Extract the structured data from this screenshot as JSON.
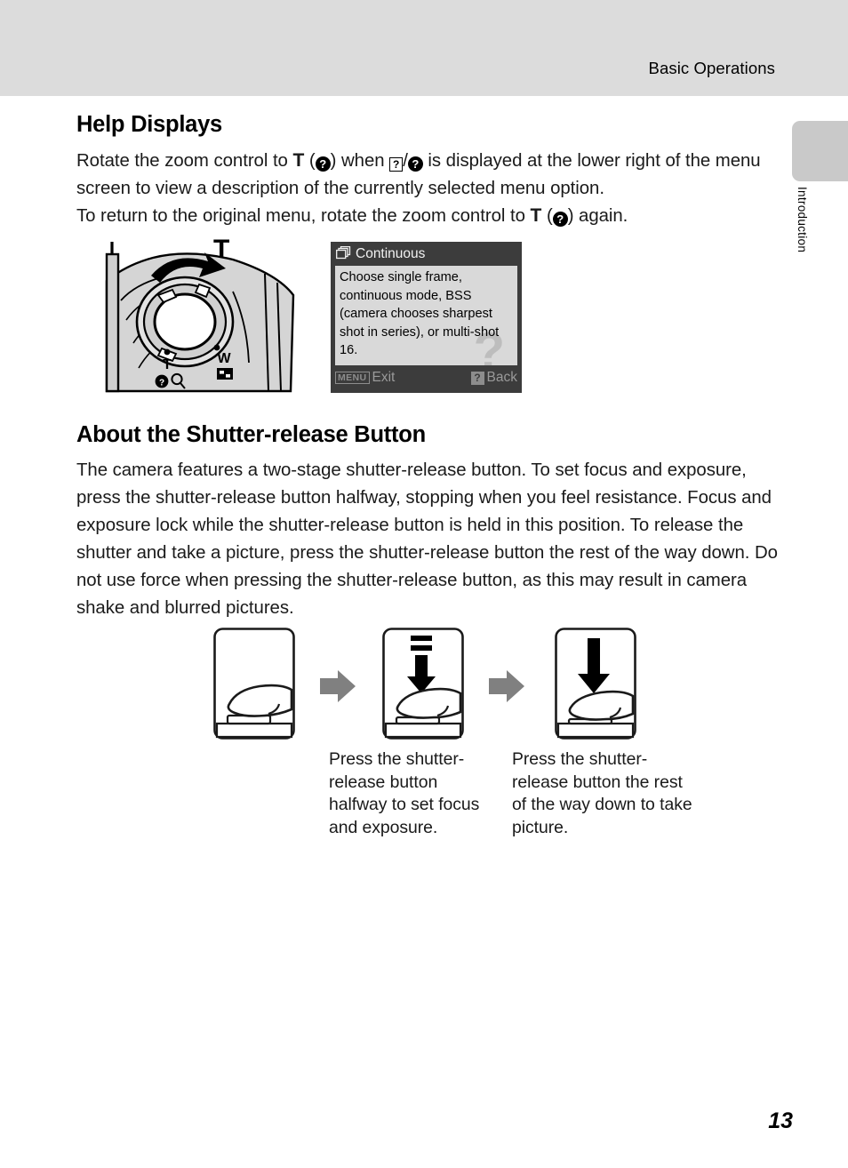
{
  "header": {
    "title": "Basic Operations"
  },
  "side_tab": {
    "label": "Introduction"
  },
  "sections": {
    "help_displays": {
      "heading": "Help Displays",
      "para1_a": "Rotate the zoom control to ",
      "para1_T": "T",
      "para1_b": " (",
      "para1_q1": "?",
      "para1_c": ") when ",
      "para1_q2": "?",
      "para1_slash": "/",
      "para1_q3": "?",
      "para1_d": " is displayed at the lower right of the menu screen to view a description of the currently selected menu option.",
      "para2_a": "To return to the original menu, rotate the zoom control to ",
      "para2_T": "T",
      "para2_b": " (",
      "para2_q": "?",
      "para2_c": ") again."
    },
    "shutter": {
      "heading": "About the Shutter-release Button",
      "body": "The camera features a two-stage shutter-release button. To set focus and exposure, press the shutter-release button halfway, stopping when you feel resistance. Focus and exposure lock while the shutter-release button is held in this position. To release the shutter and take a picture, press the shutter-release button the rest of the way down. Do not use force when pressing the shutter-release button, as this may result in camera shake and blurred pictures.",
      "caption_halfway": "Press the shutter-release button halfway to set focus and exposure.",
      "caption_full": "Press the shutter-release button the rest of the way down to take picture."
    }
  },
  "camera_figure": {
    "zoom_label_T_big": "T",
    "marking_T": "T",
    "marking_W": "W",
    "marking_help": "?"
  },
  "lcd": {
    "title": "Continuous",
    "body": "Choose single frame, continuous mode, BSS (camera chooses sharpest shot in series), or multi-shot 16.",
    "watermark": "?",
    "menu_badge": "MENU",
    "exit_label": "Exit",
    "back_badge": "?",
    "back_label": "Back"
  },
  "footer": {
    "page_number": "13"
  },
  "colors": {
    "header_band": "#dcdcdc",
    "side_tab": "#c9c9c9",
    "lcd_frame": "#3c3c3c",
    "lcd_body": "#d9d9d9",
    "arrow_gray": "#808080"
  }
}
